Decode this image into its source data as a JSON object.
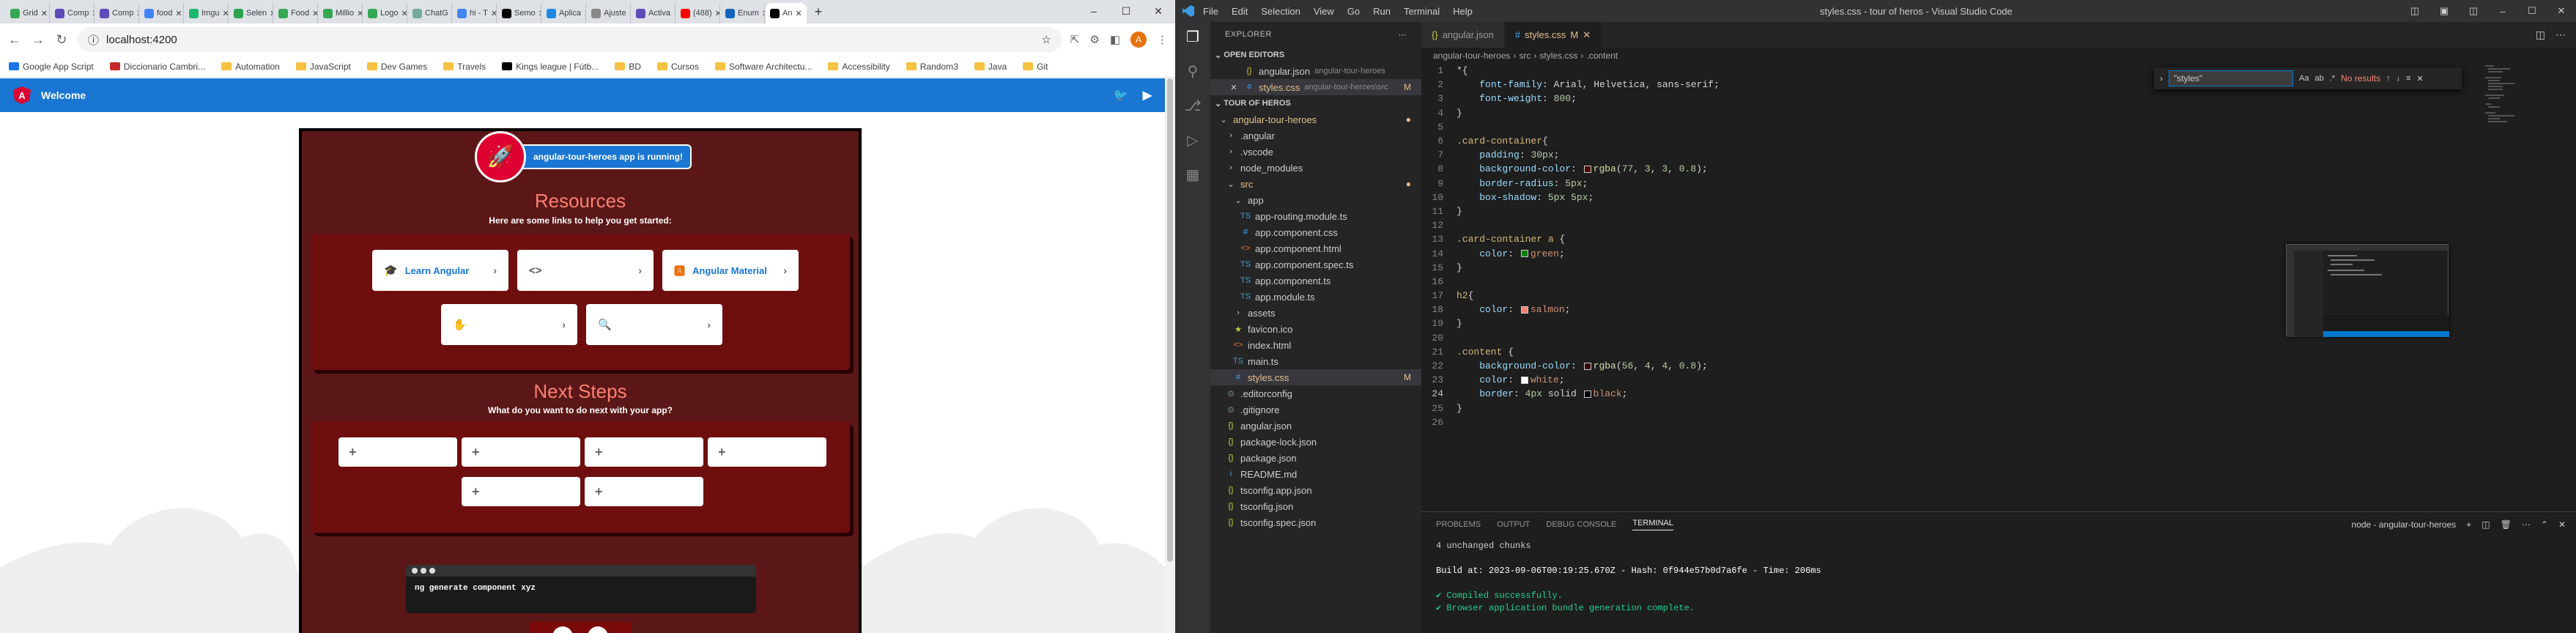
{
  "chrome": {
    "tabs": [
      {
        "label": "Grid",
        "color": "#34a853"
      },
      {
        "label": "Comp",
        "color": "#5c4bb8"
      },
      {
        "label": "Comp",
        "color": "#5c4bb8"
      },
      {
        "label": "food",
        "color": "#4285f4"
      },
      {
        "label": "Imgu",
        "color": "#1bb76e"
      },
      {
        "label": "Selen",
        "color": "#2ea44f"
      },
      {
        "label": "Food",
        "color": "#34a853"
      },
      {
        "label": "Millio",
        "color": "#34a853"
      },
      {
        "label": "Logo",
        "color": "#34a853"
      },
      {
        "label": "ChatG",
        "color": "#74aa9c"
      },
      {
        "label": "hi - T",
        "color": "#4285f4"
      },
      {
        "label": "Semo",
        "color": "#000000"
      },
      {
        "label": "Aplica",
        "color": "#1e88e5"
      },
      {
        "label": "Ajuste",
        "color": "#888888"
      },
      {
        "label": "Activa",
        "color": "#5c4bb8"
      },
      {
        "label": "(488)",
        "color": "#ff0000"
      },
      {
        "label": "Enum",
        "color": "#1565c0"
      },
      {
        "label": "An",
        "color": "#000000",
        "active": true
      }
    ],
    "window_controls": [
      "–",
      "☐",
      "✕"
    ],
    "url": "localhost:4200",
    "bookmarks": [
      "Google App Script",
      "Diccionario Cambri...",
      "Automation",
      "JavaScript",
      "Dev Games",
      "Travels",
      "Kings league | Fútb...",
      "BD",
      "Cursos",
      "Software Architectu...",
      "Accessibility",
      "Random3",
      "Java",
      "Git"
    ],
    "bookmark_icon_colors": [
      "#1a73e8",
      "#c62828",
      "#f5c242",
      "#f5c242",
      "#f5c242",
      "#f5c242",
      "#000000",
      "#f5c242",
      "#f5c242",
      "#f5c242",
      "#f5c242",
      "#f5c242",
      "#f5c242",
      "#f5c242"
    ],
    "avatar_letter": "A"
  },
  "app": {
    "header_title": "Welcome",
    "running_text": "angular-tour-heroes app is running!",
    "resources_title": "Resources",
    "resources_sub": "Here are some links to help you get started:",
    "resource_cards": [
      {
        "label": "Learn Angular",
        "icon": "🎓"
      },
      {
        "label": "",
        "icon": "<>"
      },
      {
        "label": "Angular Material",
        "icon": "🅰"
      }
    ],
    "resource_cards_row2": [
      {
        "label": "",
        "icon": "✋"
      },
      {
        "label": "",
        "icon": "🔍"
      }
    ],
    "next_title": "Next Steps",
    "next_sub": "What do you want to do next with your app?",
    "terminal_command": "ng generate component xyz",
    "next_buttons": [
      "+",
      "+",
      "+",
      "+",
      "+",
      "+"
    ]
  },
  "vscode": {
    "menus": [
      "File",
      "Edit",
      "Selection",
      "View",
      "Go",
      "Run",
      "Terminal",
      "Help"
    ],
    "window_title": "styles.css - tour of heros - Visual Studio Code",
    "explorer_label": "EXPLORER",
    "open_editors_label": "OPEN EDITORS",
    "open_editors": [
      {
        "name": "angular.json",
        "desc": "angular-tour-heroes",
        "badge": ""
      },
      {
        "name": "styles.css",
        "desc": "angular-tour-heroes\\src",
        "badge": "M"
      }
    ],
    "workspace_label": "TOUR OF HEROS",
    "tree": [
      {
        "name": "angular-tour-heroes",
        "kind": "folder-open",
        "depth": 1,
        "badge": "●"
      },
      {
        "name": ".angular",
        "kind": "folder",
        "depth": 2,
        "badge": ""
      },
      {
        "name": ".vscode",
        "kind": "folder",
        "depth": 2,
        "badge": ""
      },
      {
        "name": "node_modules",
        "kind": "folder",
        "depth": 2,
        "badge": ""
      },
      {
        "name": "src",
        "kind": "folder-open",
        "depth": 2,
        "badge": "●"
      },
      {
        "name": "app",
        "kind": "folder-open",
        "depth": 3,
        "badge": ""
      },
      {
        "name": "app-routing.module.ts",
        "kind": "ts",
        "depth": 4,
        "badge": ""
      },
      {
        "name": "app.component.css",
        "kind": "css",
        "depth": 4,
        "badge": ""
      },
      {
        "name": "app.component.html",
        "kind": "html",
        "depth": 4,
        "badge": ""
      },
      {
        "name": "app.component.spec.ts",
        "kind": "ts",
        "depth": 4,
        "badge": ""
      },
      {
        "name": "app.component.ts",
        "kind": "ts",
        "depth": 4,
        "badge": ""
      },
      {
        "name": "app.module.ts",
        "kind": "ts",
        "depth": 4,
        "badge": ""
      },
      {
        "name": "assets",
        "kind": "folder",
        "depth": 3,
        "badge": ""
      },
      {
        "name": "favicon.ico",
        "kind": "ico",
        "depth": 3,
        "badge": ""
      },
      {
        "name": "index.html",
        "kind": "html",
        "depth": 3,
        "badge": ""
      },
      {
        "name": "main.ts",
        "kind": "ts",
        "depth": 3,
        "badge": ""
      },
      {
        "name": "styles.css",
        "kind": "css",
        "depth": 3,
        "badge": "M",
        "selected": true
      },
      {
        "name": ".editorconfig",
        "kind": "cfg",
        "depth": 2,
        "badge": ""
      },
      {
        "name": ".gitignore",
        "kind": "cfg",
        "depth": 2,
        "badge": ""
      },
      {
        "name": "angular.json",
        "kind": "json",
        "depth": 2,
        "badge": ""
      },
      {
        "name": "package-lock.json",
        "kind": "json",
        "depth": 2,
        "badge": ""
      },
      {
        "name": "package.json",
        "kind": "json",
        "depth": 2,
        "badge": ""
      },
      {
        "name": "README.md",
        "kind": "md",
        "depth": 2,
        "badge": ""
      },
      {
        "name": "tsconfig.app.json",
        "kind": "json",
        "depth": 2,
        "badge": ""
      },
      {
        "name": "tsconfig.json",
        "kind": "json",
        "depth": 2,
        "badge": ""
      },
      {
        "name": "tsconfig.spec.json",
        "kind": "json",
        "depth": 2,
        "badge": ""
      }
    ],
    "editor_tabs": [
      {
        "name": "angular.json",
        "active": false,
        "suffix": ""
      },
      {
        "name": "styles.css",
        "active": true,
        "suffix": "M"
      }
    ],
    "breadcrumb": [
      "angular-tour-heroes",
      "src",
      "styles.css",
      ".content"
    ],
    "find_query": "\"styles\"",
    "find_result": "No results",
    "code_lines": [
      [
        [
          "p",
          "*{"
        ]
      ],
      [
        [
          "p",
          "    "
        ],
        [
          "prop",
          "font-family"
        ],
        [
          "p",
          ": Arial, Helvetica, sans-serif;"
        ]
      ],
      [
        [
          "p",
          "    "
        ],
        [
          "prop",
          "font-weight"
        ],
        [
          "p",
          ": "
        ],
        [
          "num",
          "800"
        ],
        [
          "p",
          ";"
        ]
      ],
      [
        [
          "p",
          "}"
        ]
      ],
      [
        [
          "p",
          ""
        ]
      ],
      [
        [
          "sel",
          ".card-container"
        ],
        [
          "p",
          "{"
        ]
      ],
      [
        [
          "p",
          "    "
        ],
        [
          "prop",
          "padding"
        ],
        [
          "p",
          ": "
        ],
        [
          "num",
          "30px"
        ],
        [
          "p",
          ";"
        ]
      ],
      [
        [
          "p",
          "    "
        ],
        [
          "prop",
          "background-color"
        ],
        [
          "p",
          ": "
        ],
        [
          "sw",
          "#4d0303"
        ],
        [
          "fn",
          "rgba"
        ],
        [
          "p",
          "("
        ],
        [
          "num",
          "77"
        ],
        [
          "p",
          ", "
        ],
        [
          "num",
          "3"
        ],
        [
          "p",
          ", "
        ],
        [
          "num",
          "3"
        ],
        [
          "p",
          ", "
        ],
        [
          "num",
          "0.8"
        ],
        [
          "p",
          ");"
        ]
      ],
      [
        [
          "p",
          "    "
        ],
        [
          "prop",
          "border-radius"
        ],
        [
          "p",
          ": "
        ],
        [
          "num",
          "5px"
        ],
        [
          "p",
          ";"
        ]
      ],
      [
        [
          "p",
          "    "
        ],
        [
          "prop",
          "box-shadow"
        ],
        [
          "p",
          ": "
        ],
        [
          "num",
          "5px"
        ],
        [
          "p",
          " "
        ],
        [
          "num",
          "5px"
        ],
        [
          "p",
          ";"
        ]
      ],
      [
        [
          "p",
          "}"
        ]
      ],
      [
        [
          "p",
          ""
        ]
      ],
      [
        [
          "sel",
          ".card-container a"
        ],
        [
          "p",
          " {"
        ]
      ],
      [
        [
          "p",
          "    "
        ],
        [
          "prop",
          "color"
        ],
        [
          "p",
          ": "
        ],
        [
          "sw",
          "#008000"
        ],
        [
          "val",
          "green"
        ],
        [
          "p",
          ";"
        ]
      ],
      [
        [
          "p",
          "}"
        ]
      ],
      [
        [
          "p",
          ""
        ]
      ],
      [
        [
          "sel",
          "h2"
        ],
        [
          "p",
          "{"
        ]
      ],
      [
        [
          "p",
          "    "
        ],
        [
          "prop",
          "color"
        ],
        [
          "p",
          ": "
        ],
        [
          "sw",
          "#fa8072"
        ],
        [
          "val",
          "salmon"
        ],
        [
          "p",
          ";"
        ]
      ],
      [
        [
          "p",
          "}"
        ]
      ],
      [
        [
          "p",
          ""
        ]
      ],
      [
        [
          "sel",
          ".content"
        ],
        [
          "p",
          " {"
        ]
      ],
      [
        [
          "p",
          "    "
        ],
        [
          "prop",
          "background-color"
        ],
        [
          "p",
          ": "
        ],
        [
          "sw",
          "#380404"
        ],
        [
          "fn",
          "rgba"
        ],
        [
          "p",
          "("
        ],
        [
          "num",
          "56"
        ],
        [
          "p",
          ", "
        ],
        [
          "num",
          "4"
        ],
        [
          "p",
          ", "
        ],
        [
          "num",
          "4"
        ],
        [
          "p",
          ", "
        ],
        [
          "num",
          "0.8"
        ],
        [
          "p",
          ");"
        ]
      ],
      [
        [
          "p",
          "    "
        ],
        [
          "prop",
          "color"
        ],
        [
          "p",
          ": "
        ],
        [
          "sw",
          "#ffffff"
        ],
        [
          "val",
          "white"
        ],
        [
          "p",
          ";"
        ]
      ],
      [
        [
          "p",
          "    "
        ],
        [
          "prop",
          "border"
        ],
        [
          "p",
          ": "
        ],
        [
          "num",
          "4px"
        ],
        [
          "p",
          " solid "
        ],
        [
          "sw",
          "#000000"
        ],
        [
          "val",
          "black"
        ],
        [
          "p",
          ";"
        ]
      ],
      [
        [
          "p",
          "}"
        ]
      ],
      [
        [
          "p",
          ""
        ]
      ]
    ],
    "current_line": 24,
    "panel_tabs": [
      "PROBLEMS",
      "OUTPUT",
      "DEBUG CONSOLE",
      "TERMINAL"
    ],
    "panel_active": "TERMINAL",
    "terminal_name": "node - angular-tour-heroes",
    "terminal_lines": [
      {
        "text": "4 unchanged chunks",
        "cls": ""
      },
      {
        "text": "",
        "cls": ""
      },
      {
        "text": "Build at: 2023-09-06T00:19:25.670Z - Hash: 0f944e57b0d7a6fe - Time: 206ms",
        "cls": "w"
      },
      {
        "text": "",
        "cls": ""
      },
      {
        "text": "✔ Compiled successfully.",
        "cls": "g"
      },
      {
        "text": "✔ Browser application bundle generation complete.",
        "cls": "g"
      }
    ]
  }
}
